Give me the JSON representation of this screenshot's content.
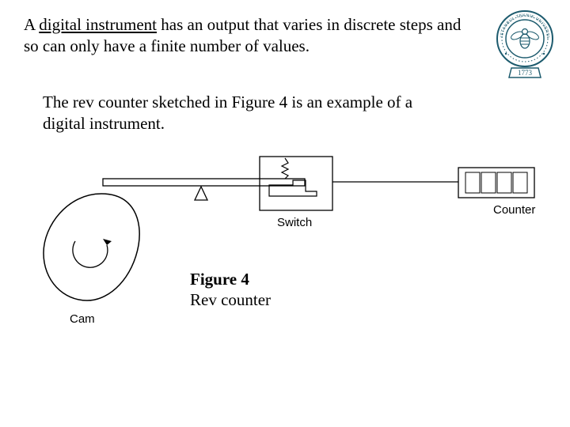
{
  "logo": {
    "inner_text": "ISTANBUL TEKNIK UNIVERSITESI",
    "year": "1773",
    "color": "#1d5b6e"
  },
  "paragraph1": {
    "prefix": "A ",
    "underlined": "digital instrument",
    "suffix": " has an output that varies in discrete steps and so can only have a finite number of values."
  },
  "paragraph2": "The rev counter sketched in Figure 4 is an example of a digital instrument.",
  "figure": {
    "label_cam": "Cam",
    "label_switch": "Switch",
    "label_counter": "Counter"
  },
  "caption": {
    "line1": "Figure 4",
    "line2": "Rev counter"
  }
}
